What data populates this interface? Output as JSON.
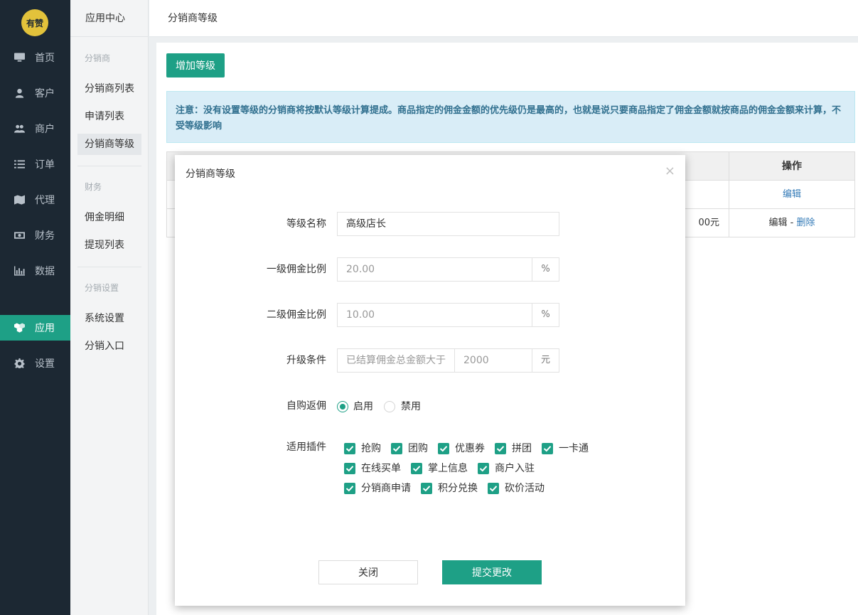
{
  "nav": {
    "logo": "有赞",
    "items": [
      {
        "label": "首页",
        "icon": "monitor-icon"
      },
      {
        "label": "客户",
        "icon": "user-icon"
      },
      {
        "label": "商户",
        "icon": "users-icon"
      },
      {
        "label": "订单",
        "icon": "list-icon"
      },
      {
        "label": "代理",
        "icon": "map-icon"
      },
      {
        "label": "财务",
        "icon": "money-icon"
      },
      {
        "label": "数据",
        "icon": "bar-chart-icon"
      },
      {
        "label": "应用",
        "icon": "cubes-icon"
      },
      {
        "label": "设置",
        "icon": "gear-icon"
      }
    ],
    "active": "应用"
  },
  "sub": {
    "title": "应用中心",
    "group1": "分销商",
    "link_list": "分销商列表",
    "link_apply": "申请列表",
    "link_level": "分销商等级",
    "group2": "财务",
    "link_commission": "佣金明细",
    "link_withdraw": "提现列表",
    "group3": "分销设置",
    "link_system": "系统设置",
    "link_entry": "分销入口"
  },
  "header": {
    "title": "分销商等级"
  },
  "main": {
    "add_button": "增加等级",
    "notice": "注意：没有设置等级的分销商将按默认等级计算提成。商品指定的佣金金额的优先级仍是最高的，也就是说只要商品指定了佣金金额就按商品的佣金金额来计算，不受等级影响",
    "table": {
      "op_header": "操作",
      "row1_op": "编辑",
      "row2_amount": "00元",
      "row2_edit": "编辑",
      "row2_sep": " - ",
      "row2_delete": "删除"
    }
  },
  "modal": {
    "title": "分销商等级",
    "close_icon": "×",
    "label_name": "等级名称",
    "value_name": "高级店长",
    "label_rate1": "一级佣金比例",
    "value_rate1": "20.00",
    "label_rate2": "二级佣金比例",
    "value_rate2": "10.00",
    "percent": "%",
    "label_upgrade": "升级条件",
    "upgrade_prefix": "已结算佣金总金额大于",
    "upgrade_value": "2000",
    "upgrade_unit": "元",
    "label_self": "自购返佣",
    "radio_on": "启用",
    "radio_off": "禁用",
    "label_plugins": "适用插件",
    "plugins": [
      "抢购",
      "团购",
      "优惠券",
      "拼团",
      "一卡通",
      "在线买单",
      "掌上信息",
      "商户入驻",
      "分销商申请",
      "积分兑换",
      "砍价活动"
    ],
    "btn_close": "关闭",
    "btn_submit": "提交更改"
  }
}
